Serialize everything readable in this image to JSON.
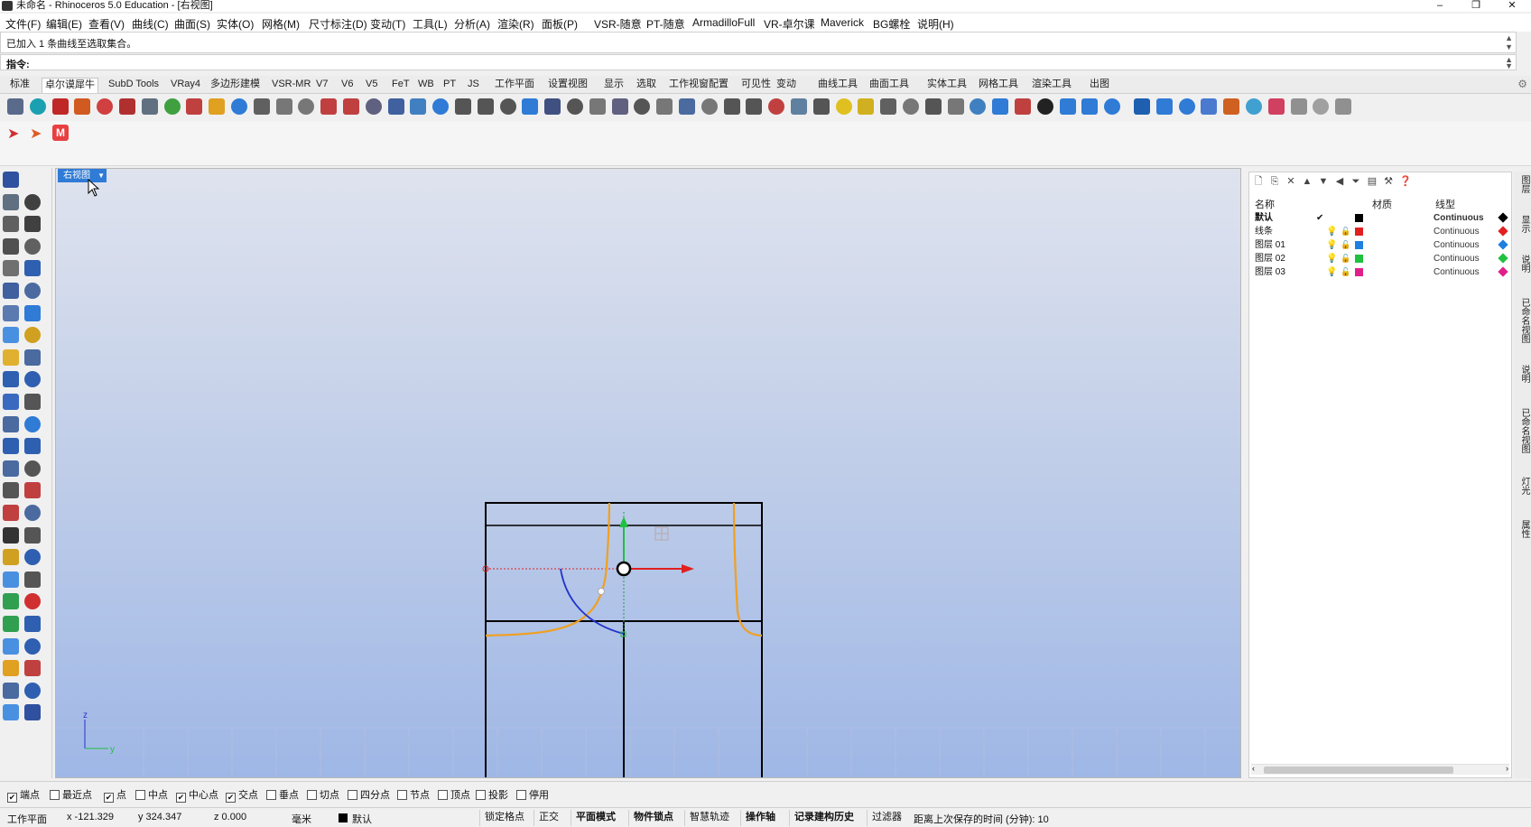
{
  "window": {
    "title": "未命名 - Rhinoceros 5.0 Education - [右视图]",
    "minimize": "–",
    "restore": "❐",
    "close": "✕"
  },
  "menu": [
    "文件(F)",
    "编辑(E)",
    "查看(V)",
    "曲线(C)",
    "曲面(S)",
    "实体(O)",
    "网格(M)",
    "尺寸标注(D)",
    "变动(T)",
    "工具(L)",
    "分析(A)",
    "渲染(R)",
    "面板(P)",
    "VSR-随意",
    "PT-随意",
    "ArmadilloFull",
    "VR-卓尔课",
    "Maverick",
    "BG螺栓",
    "说明(H)"
  ],
  "command": {
    "history": "已加入 1 条曲线至选取集合。",
    "prompt": "指令:"
  },
  "tabs": [
    "标准",
    "卓尔谟犀牛",
    "SubD Tools",
    "VRay4",
    "多边形建模",
    "VSR-MR",
    "V7",
    "V6",
    "V5",
    "FeT",
    "WB",
    "PT",
    "JS",
    "工作平面",
    "设置视图",
    "显示",
    "选取",
    "工作视窗配置",
    "可见性",
    "变动",
    "曲线工具",
    "曲面工具",
    "实体工具",
    "网格工具",
    "渲染工具",
    "出图"
  ],
  "active_tab_index": 1,
  "viewport": {
    "label": "右视图",
    "axis_z": "z",
    "axis_y": "y"
  },
  "layers_panel": {
    "headers": {
      "name": "名称",
      "material": "材质",
      "linetype": "线型"
    },
    "rows": [
      {
        "name": "默认",
        "current": "✔",
        "color": "#000000",
        "linetype": "Continuous",
        "bold": true
      },
      {
        "name": "线条",
        "current": "",
        "color": "#e02020",
        "linetype": "Continuous",
        "bold": false
      },
      {
        "name": "图层 01",
        "current": "",
        "color": "#1e7fe0",
        "linetype": "Continuous",
        "bold": false
      },
      {
        "name": "图层 02",
        "current": "",
        "color": "#20c040",
        "linetype": "Continuous",
        "bold": false
      },
      {
        "name": "图层 03",
        "current": "",
        "color": "#e0208a",
        "linetype": "Continuous",
        "bold": false
      }
    ]
  },
  "side_tabs": [
    "图层",
    "显示",
    "说明",
    "已命名视图",
    "说明",
    "已命名视图",
    "灯光",
    "属性"
  ],
  "osnaps": [
    {
      "label": "端点",
      "checked": true
    },
    {
      "label": "最近点",
      "checked": false
    },
    {
      "label": "点",
      "checked": true
    },
    {
      "label": "中点",
      "checked": false
    },
    {
      "label": "中心点",
      "checked": true
    },
    {
      "label": "交点",
      "checked": true
    },
    {
      "label": "垂点",
      "checked": false
    },
    {
      "label": "切点",
      "checked": false
    },
    {
      "label": "四分点",
      "checked": false
    },
    {
      "label": "节点",
      "checked": false
    },
    {
      "label": "顶点",
      "checked": false
    },
    {
      "label": "投影",
      "checked": false
    },
    {
      "label": "停用",
      "checked": false
    }
  ],
  "status": {
    "cplane": "工作平面",
    "x": "x -121.329",
    "y": "y 324.347",
    "z": "z 0.000",
    "units": "毫米",
    "layer": "默认",
    "buttons": [
      "锁定格点",
      "正交",
      "平面模式",
      "物件锁点",
      "智慧轨迹",
      "操作轴",
      "记录建构历史",
      "过滤器"
    ],
    "bold_buttons": [
      "平面模式",
      "物件锁点",
      "操作轴",
      "记录建构历史"
    ],
    "save_info": "距离上次保存的时间 (分钟): 10"
  },
  "colors": {
    "accent": "#2f7bd6",
    "curve_orange": "#f0a020",
    "curve_blue": "#2233cc",
    "gumball_x": "#e02020",
    "gumball_z": "#20c040"
  }
}
